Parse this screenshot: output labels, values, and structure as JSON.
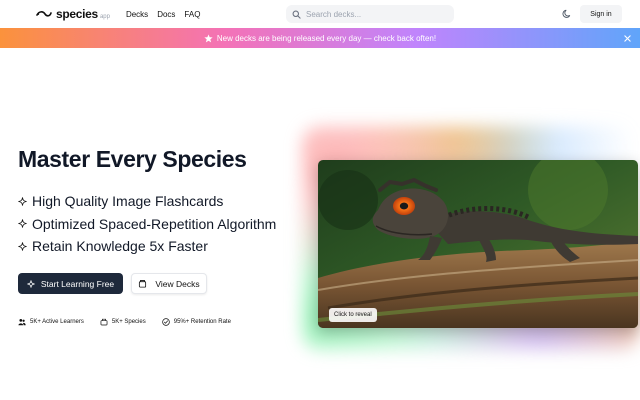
{
  "header": {
    "logo_text": "species",
    "logo_sub": "app",
    "nav": [
      "Decks",
      "Docs",
      "FAQ"
    ],
    "search_placeholder": "Search decks...",
    "signin_label": "Sign in"
  },
  "banner": {
    "text": "New decks are being released every day — check back often!"
  },
  "hero": {
    "title": "Master Every Species",
    "features": [
      "High Quality Image Flashcards",
      "Optimized Spaced-Repetition Algorithm",
      "Retain Knowledge 5x Faster"
    ],
    "primary_button": "Start Learning Free",
    "secondary_button": "View Decks",
    "stats": [
      "5K+ Active Learners",
      "5K+ Species",
      "95%+ Retention Rate"
    ]
  },
  "card": {
    "reveal_label": "Click to reveal"
  },
  "colors": {
    "primary_button": "#1e293b",
    "text": "#111827",
    "banner_gradient": [
      "#fb923c",
      "#f472b6",
      "#c084fc",
      "#60a5fa"
    ]
  },
  "icons": {
    "logo": "lizard-logo-icon",
    "search": "search-icon",
    "theme": "moon-icon",
    "banner": "star-icon",
    "close": "close-icon",
    "feature": "sparkle-icon",
    "primary_button": "sparkle-icon",
    "secondary_button": "cards-icon",
    "stats": [
      "users-icon",
      "species-icon",
      "check-circle-icon"
    ]
  }
}
